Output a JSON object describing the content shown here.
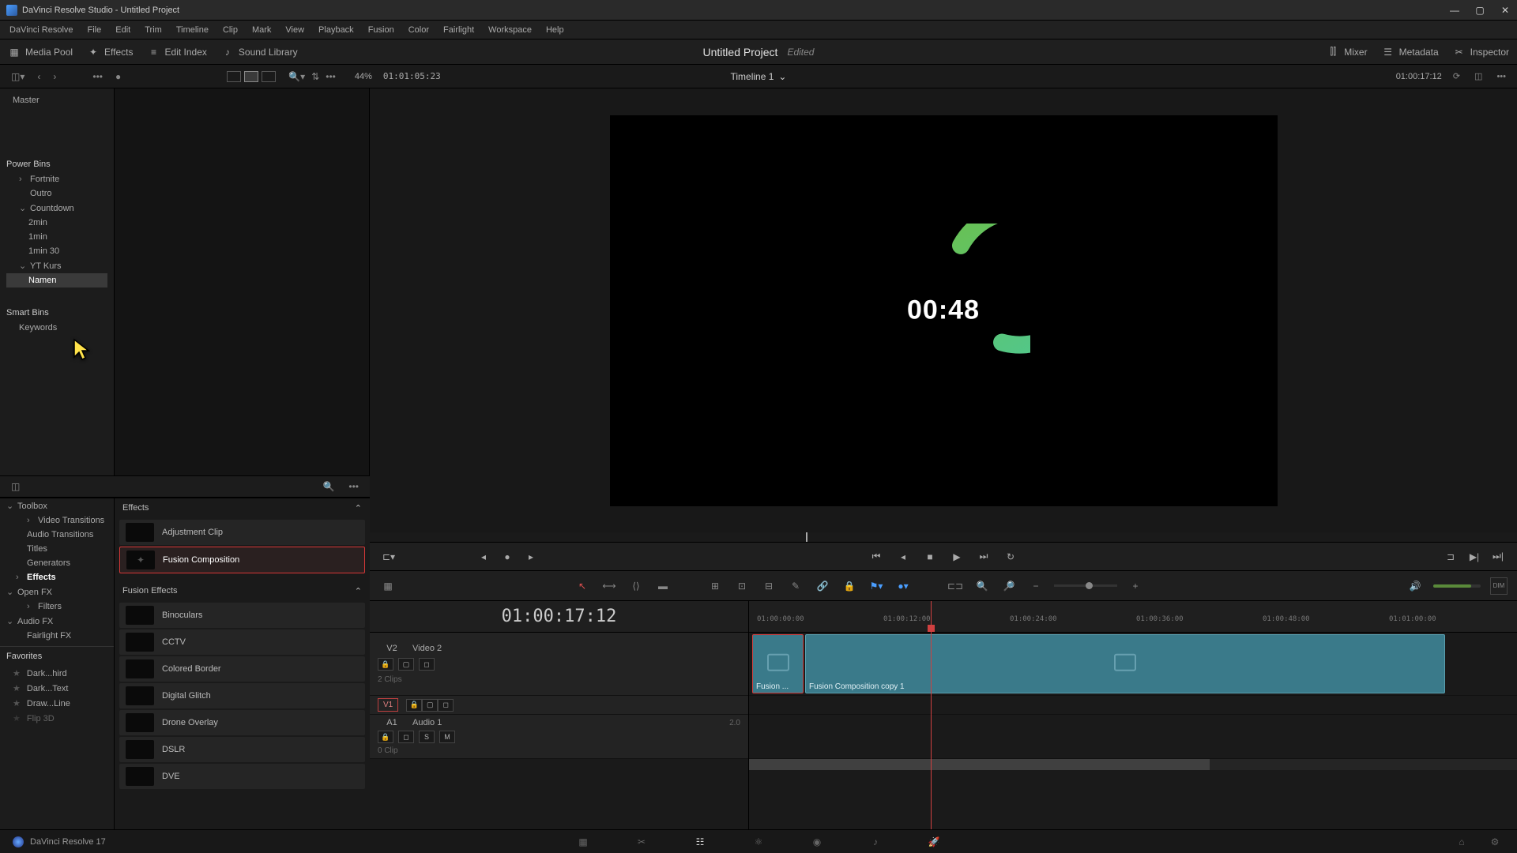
{
  "window": {
    "title": "DaVinci Resolve Studio - Untitled Project"
  },
  "menubar": [
    "DaVinci Resolve",
    "File",
    "Edit",
    "Trim",
    "Timeline",
    "Clip",
    "Mark",
    "View",
    "Playback",
    "Fusion",
    "Color",
    "Fairlight",
    "Workspace",
    "Help"
  ],
  "toolbar": {
    "media_pool": "Media Pool",
    "effects": "Effects",
    "edit_index": "Edit Index",
    "sound_library": "Sound Library",
    "mixer": "Mixer",
    "metadata": "Metadata",
    "inspector": "Inspector"
  },
  "project": {
    "name": "Untitled Project",
    "status": "Edited"
  },
  "subbar": {
    "zoom": "44%",
    "tc": "01:01:05:23",
    "timeline_name": "Timeline 1",
    "right_tc": "01:00:17:12"
  },
  "media_sidebar": {
    "master": "Master",
    "power_bins": "Power Bins",
    "bins": [
      {
        "label": "Fortnite",
        "indent": 1,
        "chev": "›"
      },
      {
        "label": "Outro",
        "indent": 1,
        "chev": ""
      },
      {
        "label": "Countdown",
        "indent": 1,
        "chev": "⌄"
      },
      {
        "label": "2min",
        "indent": 2,
        "chev": ""
      },
      {
        "label": "1min",
        "indent": 2,
        "chev": ""
      },
      {
        "label": "1min 30",
        "indent": 2,
        "chev": ""
      },
      {
        "label": "YT Kurs",
        "indent": 1,
        "chev": "⌄"
      },
      {
        "label": "Namen",
        "indent": 2,
        "chev": "",
        "selected": true
      }
    ],
    "smart_bins": "Smart Bins",
    "keywords": "Keywords"
  },
  "effects_sidebar": {
    "toolbox": "Toolbox",
    "items": [
      {
        "label": "Video Transitions",
        "chev": "›"
      },
      {
        "label": "Audio Transitions",
        "chev": ""
      },
      {
        "label": "Titles",
        "chev": ""
      },
      {
        "label": "Generators",
        "chev": ""
      },
      {
        "label": "Effects",
        "chev": "›",
        "active": true
      }
    ],
    "openfx": "Open FX",
    "filters": "Filters",
    "audiofx": "Audio FX",
    "fairlightfx": "Fairlight FX",
    "favorites": "Favorites",
    "fav_items": [
      "Dark...hird",
      "Dark...Text",
      "Draw...Line",
      "Flip 3D"
    ]
  },
  "effects_panel": {
    "cat1": "Effects",
    "cat2": "Fusion Effects",
    "list1": [
      {
        "name": "Adjustment Clip"
      },
      {
        "name": "Fusion Composition",
        "selected": true
      }
    ],
    "list2": [
      {
        "name": "Binoculars"
      },
      {
        "name": "CCTV"
      },
      {
        "name": "Colored Border"
      },
      {
        "name": "Digital Glitch"
      },
      {
        "name": "Drone Overlay"
      },
      {
        "name": "DSLR"
      },
      {
        "name": "DVE"
      }
    ]
  },
  "viewer": {
    "countdown": "00:48"
  },
  "timeline": {
    "big_tc": "01:00:17:12",
    "ruler": [
      "01:00:00:00",
      "01:00:12:00",
      "01:00:24:00",
      "01:00:36:00",
      "01:00:48:00",
      "01:01:00:00"
    ],
    "v2": {
      "id": "V2",
      "name": "Video 2",
      "clips_info": "2 Clips"
    },
    "v1": {
      "id": "V1"
    },
    "a1": {
      "id": "A1",
      "name": "Audio 1",
      "ch": "2.0",
      "clips_info": "0 Clip"
    },
    "clip1": "Fusion ...",
    "clip2": "Fusion Composition copy 1"
  },
  "footer": {
    "app": "DaVinci Resolve 17"
  }
}
